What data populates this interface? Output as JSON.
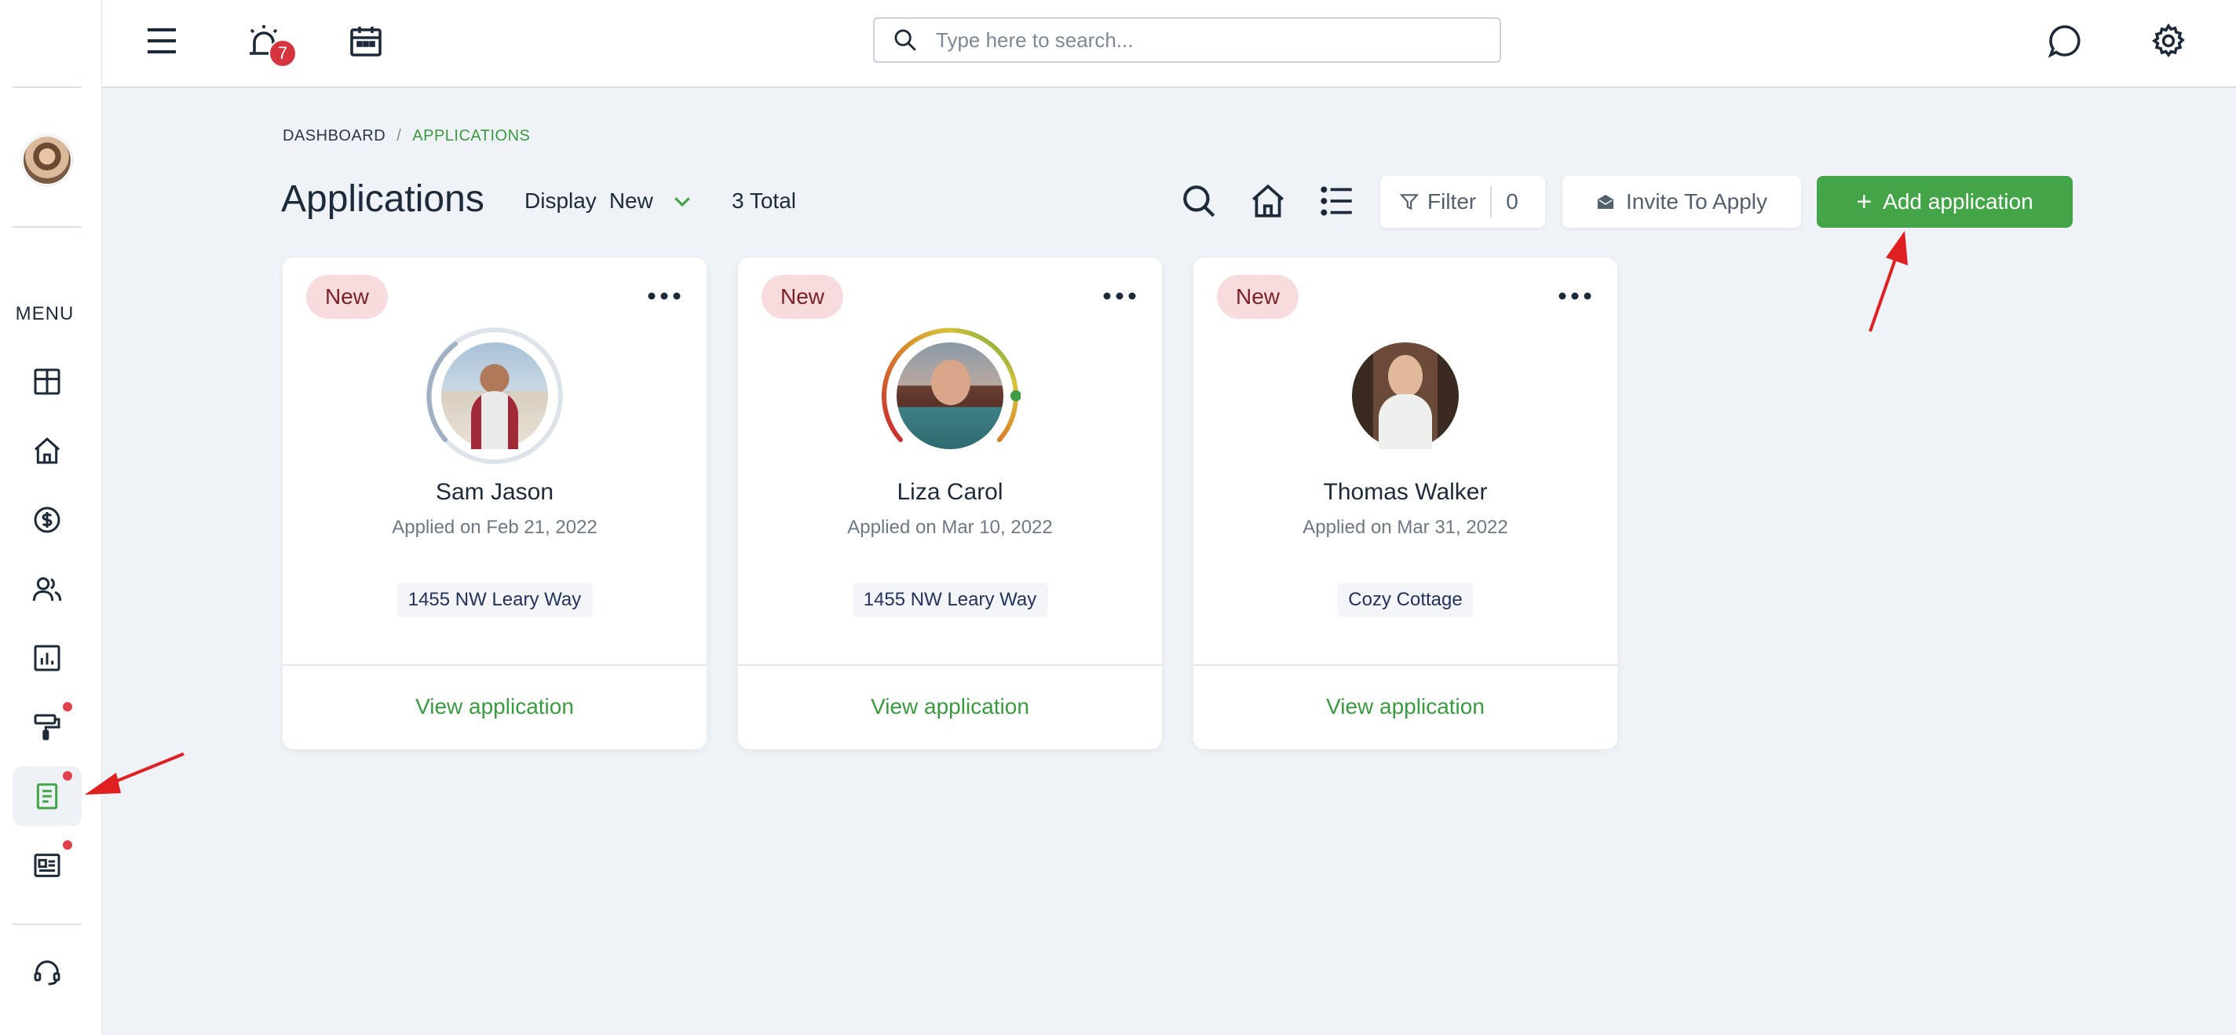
{
  "sidebar": {
    "menu_label": "MENU",
    "items": [
      {
        "name": "dashboard",
        "icon": "layout-grid-icon"
      },
      {
        "name": "properties",
        "icon": "home-icon"
      },
      {
        "name": "payments",
        "icon": "dollar-circle-icon"
      },
      {
        "name": "people",
        "icon": "users-icon"
      },
      {
        "name": "reports",
        "icon": "bar-chart-icon"
      },
      {
        "name": "maintenance",
        "icon": "paint-roller-icon",
        "dot": true
      },
      {
        "name": "applications",
        "icon": "document-icon",
        "dot": true,
        "active": true
      },
      {
        "name": "listings",
        "icon": "newspaper-icon",
        "dot": true
      }
    ],
    "support_icon": "headset-icon"
  },
  "topbar": {
    "notification_count": "7",
    "search_placeholder": "Type here to search..."
  },
  "breadcrumb": {
    "first": "DASHBOARD",
    "separator": "/",
    "current": "APPLICATIONS"
  },
  "header": {
    "title": "Applications",
    "display_label": "Display",
    "display_value": "New",
    "total": "3 Total",
    "filter_label": "Filter",
    "filter_count": "0",
    "invite_label": "Invite To Apply",
    "add_label": "Add application"
  },
  "cards": [
    {
      "status": "New",
      "name": "Sam Jason",
      "applied": "Applied on Feb 21, 2022",
      "property": "1455 NW Leary Way",
      "view": "View application"
    },
    {
      "status": "New",
      "name": "Liza Carol",
      "applied": "Applied on Mar 10, 2022",
      "property": "1455 NW Leary Way",
      "view": "View application"
    },
    {
      "status": "New",
      "name": "Thomas Walker",
      "applied": "Applied on Mar 31, 2022",
      "property": "Cozy Cottage",
      "view": "View application"
    }
  ],
  "colors": {
    "accent_green": "#43a548",
    "badge_red": "#d6353f",
    "tag_bg": "#f8dcdd",
    "annotation_arrow": "#e02020"
  }
}
